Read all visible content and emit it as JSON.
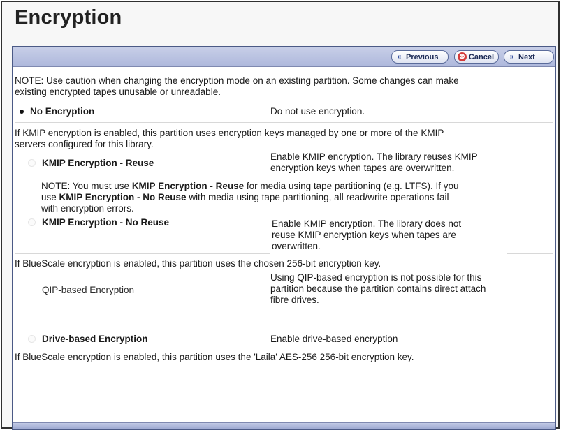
{
  "page": {
    "title": "Encryption"
  },
  "toolbar": {
    "previous_label": "Previous",
    "cancel_label": "Cancel",
    "next_label": "Next"
  },
  "notes": {
    "top_line1": "NOTE: Use caution when changing the encryption mode on an existing partition. Some changes can make",
    "top_line2": "existing encrypted tapes unusable or unreadable."
  },
  "options": {
    "no_encryption": {
      "label": "No Encryption",
      "description": "Do not use encryption.",
      "selected": true
    }
  },
  "kmip": {
    "intro_line1": "If KMIP encryption is enabled, this partition uses encryption keys managed by one or more of the KMIP",
    "intro_line2": "servers configured for this library.",
    "reuse": {
      "label": "KMIP Encryption - Reuse",
      "desc_line1": "Enable KMIP encryption. The library reuses KMIP",
      "desc_line2": "encryption keys when tapes are overwritten."
    },
    "note": {
      "p1": "NOTE: You must use ",
      "b1": "KMIP Encryption - Reuse",
      "p2": " for media using tape partitioning (e.g. LTFS). If you",
      "p3": "use ",
      "b2": "KMIP Encryption - No Reuse",
      "p4": " with media using tape partitioning, all read/write operations fail",
      "p5": "with encryption errors."
    },
    "no_reuse": {
      "label": "KMIP Encryption - No Reuse",
      "desc_line1": "Enable KMIP encryption. The library does not",
      "desc_line2": "reuse KMIP encryption keys when tapes are",
      "desc_line3": "overwritten."
    }
  },
  "bluescale": {
    "intro": "If BlueScale encryption is enabled, this partition uses the chosen 256-bit encryption key.",
    "qip": {
      "label": "QIP-based Encryption",
      "desc_line1": "Using QIP-based encryption is not possible for this",
      "desc_line2": "partition because the partition contains direct attach",
      "desc_line3": "fibre drives."
    },
    "drive": {
      "label": "Drive-based Encryption",
      "description": "Enable drive-based encryption"
    },
    "footer": "If BlueScale encryption is enabled, this partition uses the 'Laila' AES-256 256-bit encryption key."
  },
  "colors": {
    "toolbar": "#b6c0e0",
    "cancel_icon": "#d43b3b",
    "panel_border": "#4b5a86"
  }
}
